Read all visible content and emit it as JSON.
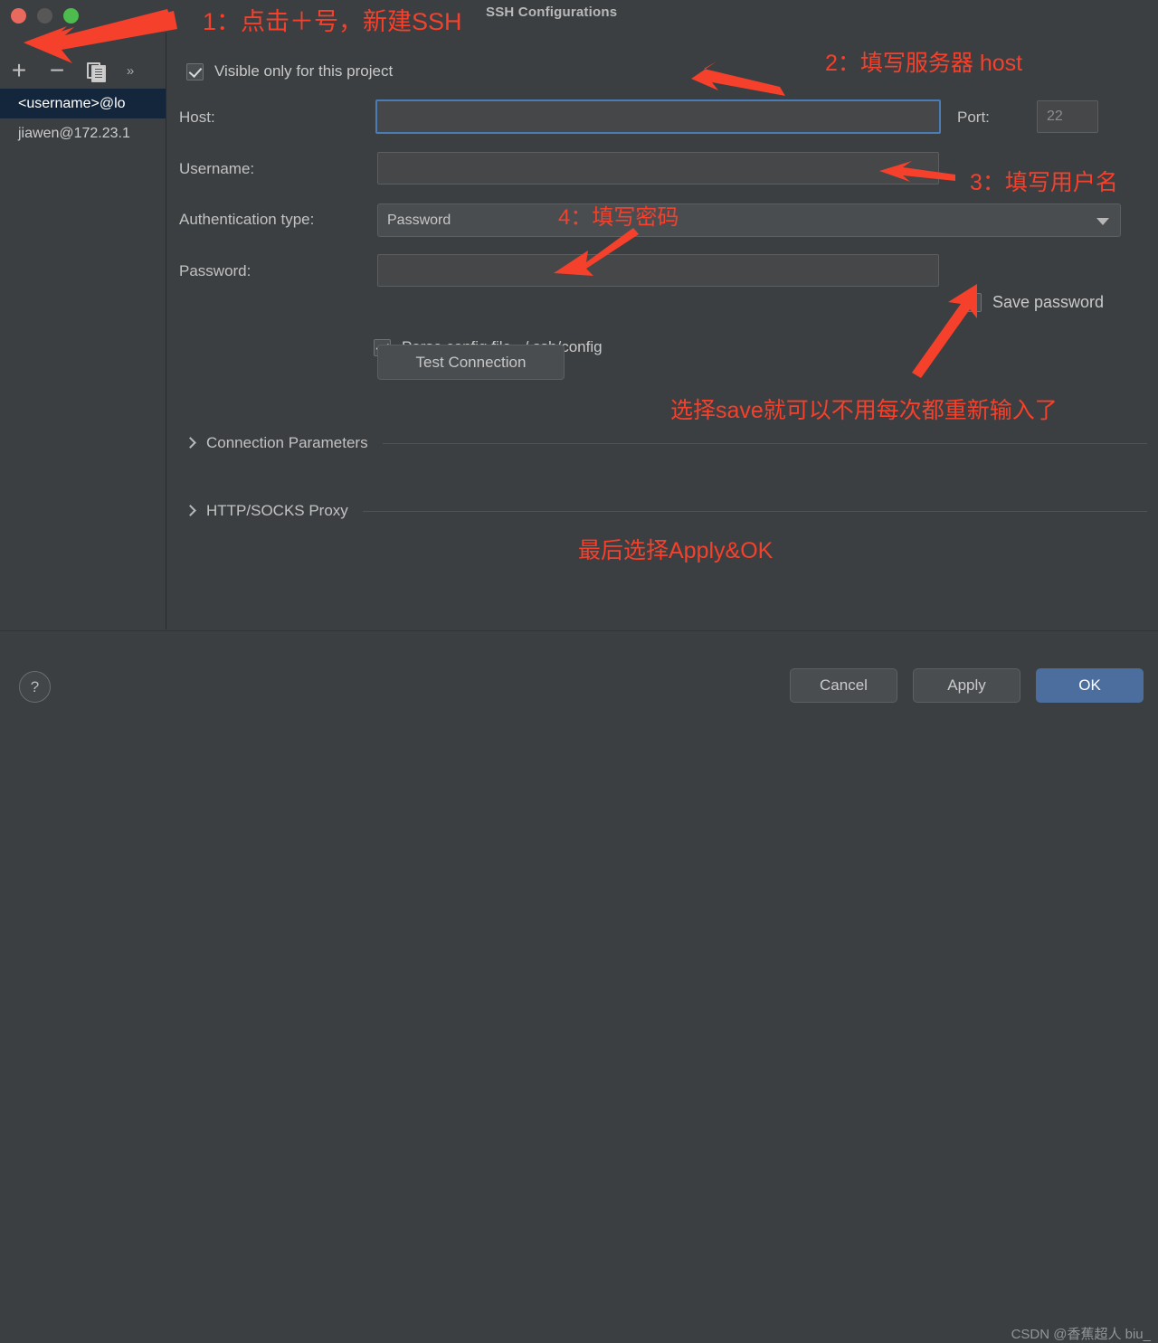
{
  "window": {
    "title": "SSH Configurations",
    "traffic_lights": [
      "close-red",
      "minimize-gray",
      "zoom-green"
    ]
  },
  "sidebar": {
    "toolbar": [
      {
        "name": "add",
        "glyph": "+"
      },
      {
        "name": "remove",
        "glyph": "−"
      },
      {
        "name": "copy",
        "glyph": "copy"
      },
      {
        "name": "more",
        "glyph": "»"
      }
    ],
    "items": [
      {
        "label": "<username>@lo",
        "selected": true
      },
      {
        "label": "jiawen@172.23.1",
        "selected": false
      }
    ]
  },
  "form": {
    "visible_only_checkbox": {
      "label": "Visible only for this project",
      "checked": true
    },
    "host": {
      "label": "Host:",
      "value": "",
      "focused": true
    },
    "port": {
      "label": "Port:",
      "value": "22"
    },
    "username": {
      "label": "Username:",
      "value": ""
    },
    "auth_type": {
      "label": "Authentication type:",
      "value": "Password"
    },
    "password": {
      "label": "Password:",
      "value": ""
    },
    "save_password": {
      "label": "Save password",
      "checked": false
    },
    "parse_config": {
      "label": "Parse config file ~/.ssh/config",
      "checked": true
    },
    "test_connection_button": "Test Connection",
    "sections": [
      {
        "label": "Connection Parameters",
        "expanded": false
      },
      {
        "label": "HTTP/SOCKS Proxy",
        "expanded": false
      }
    ]
  },
  "footer": {
    "help": "?",
    "cancel": "Cancel",
    "apply": "Apply",
    "ok": "OK",
    "watermark": "CSDN @香蕉超人 biu_"
  },
  "annotations": {
    "color": "#f5402c",
    "step1": "1：点击＋号，新建SSH",
    "step2": "2：填写服务器 host",
    "step3": "3：填写用户名",
    "step4": "4：填写密码",
    "save_note": "选择save就可以不用每次都重新输入了",
    "final_note": "最后选择Apply&OK"
  }
}
